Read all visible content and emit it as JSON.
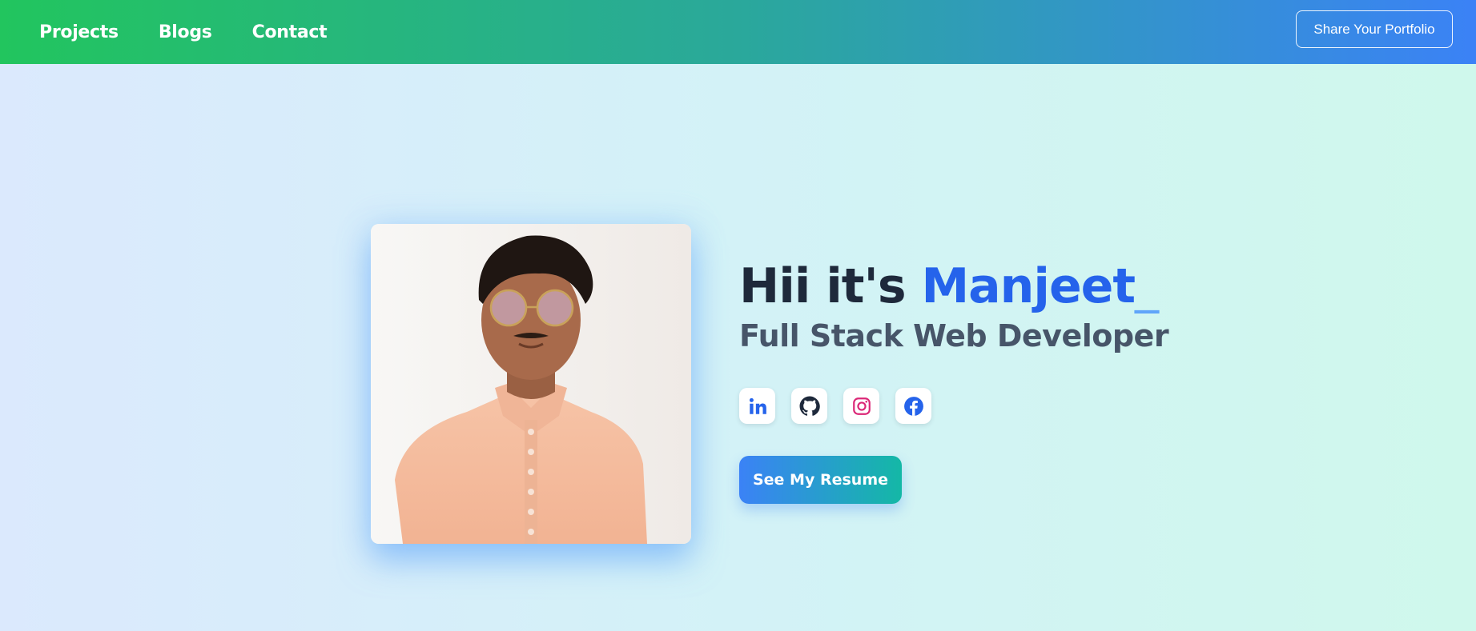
{
  "nav": {
    "links": [
      {
        "label": "Projects"
      },
      {
        "label": "Blogs"
      },
      {
        "label": "Contact"
      }
    ],
    "share_label": "Share Your Portfolio"
  },
  "hero": {
    "greeting": "Hii it's ",
    "name": "Manjeet",
    "cursor": "_",
    "subtitle": "Full Stack Web Developer",
    "resume_label": "See My Resume"
  },
  "socials": [
    {
      "icon": "linkedin-icon",
      "color": "#2563eb"
    },
    {
      "icon": "github-icon",
      "color": "#1e293b"
    },
    {
      "icon": "instagram-icon",
      "color": "#db2777"
    },
    {
      "icon": "facebook-icon",
      "color": "#2563eb"
    }
  ],
  "colors": {
    "accent": "#2563eb",
    "nav_gradient_start": "#22c55e",
    "nav_gradient_end": "#3b82f6"
  }
}
